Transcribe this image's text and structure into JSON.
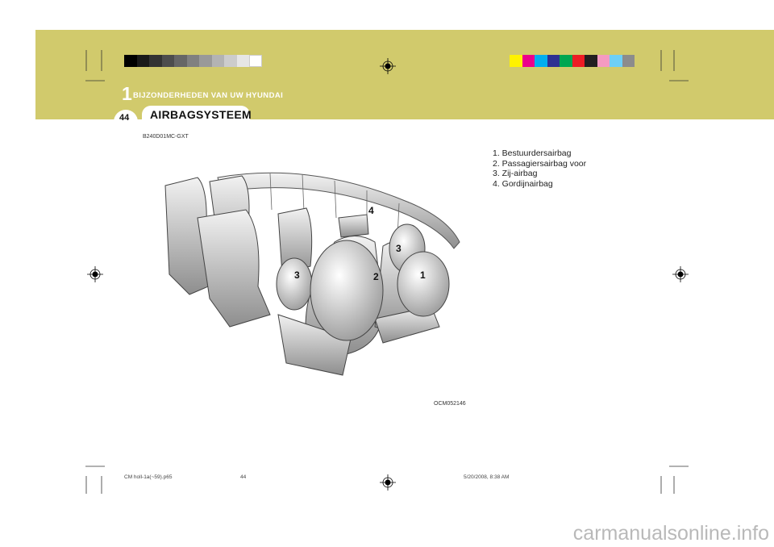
{
  "header": {
    "chapter_number": "1",
    "chapter_title": "BIJZONDERHEDEN VAN UW HYUNDAI",
    "section_title": "AIRBAGSYSTEEM",
    "page_number": "44"
  },
  "colors": {
    "band": "#d1ca6c",
    "gray_bar": [
      "#000000",
      "#1a1a1a",
      "#333333",
      "#4d4d4d",
      "#666666",
      "#808080",
      "#999999",
      "#b3b3b3",
      "#cccccc",
      "#e6e6e6",
      "#ffffff"
    ],
    "color_bar": [
      "#fff200",
      "#ec008c",
      "#00aeef",
      "#2e3192",
      "#00a651",
      "#ed1c24",
      "#231f20",
      "#f49ac1",
      "#6dcff6",
      "#8c8c8c"
    ]
  },
  "doc_code": "B240D01MC-GXT",
  "figure_code": "OCM052146",
  "legend": [
    "1. Bestuurdersairbag",
    "2. Passagiersairbag voor",
    "3. Zij-airbag",
    "4. Gordijnairbag"
  ],
  "callouts": [
    "1",
    "2",
    "3",
    "3",
    "4"
  ],
  "footer": {
    "file_name": "CM holl-1a(~59).p65",
    "page_ref": "44",
    "timestamp": "5/20/2008, 8:38 AM"
  },
  "watermark": "carmanualsonline.info"
}
